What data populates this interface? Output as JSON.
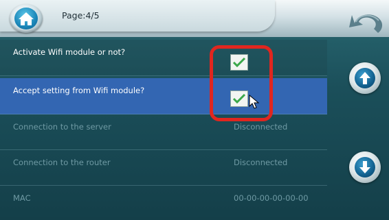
{
  "header": {
    "page_indicator": "Page:4/5"
  },
  "settings": [
    {
      "label": "Activate Wifi module or not?",
      "control": "checkbox",
      "checked": true
    },
    {
      "label": "Accept setting from Wifi module?",
      "control": "checkbox",
      "checked": true,
      "selected": true
    },
    {
      "label": "Connection to the server",
      "value": "Disconnected"
    },
    {
      "label": "Connection to the router",
      "value": "Disconnected"
    },
    {
      "label": "MAC",
      "value": "00-00-00-00-00-00"
    }
  ],
  "icons": {
    "home": "home-icon",
    "back": "back-arrow-icon",
    "scroll_up": "arrow-up-icon",
    "scroll_down": "arrow-down-icon",
    "check": "checkmark-icon",
    "cursor": "mouse-cursor-icon"
  },
  "colors": {
    "selected_row": "#3366b2",
    "highlight": "#e0261f",
    "check": "#3aa84a"
  }
}
